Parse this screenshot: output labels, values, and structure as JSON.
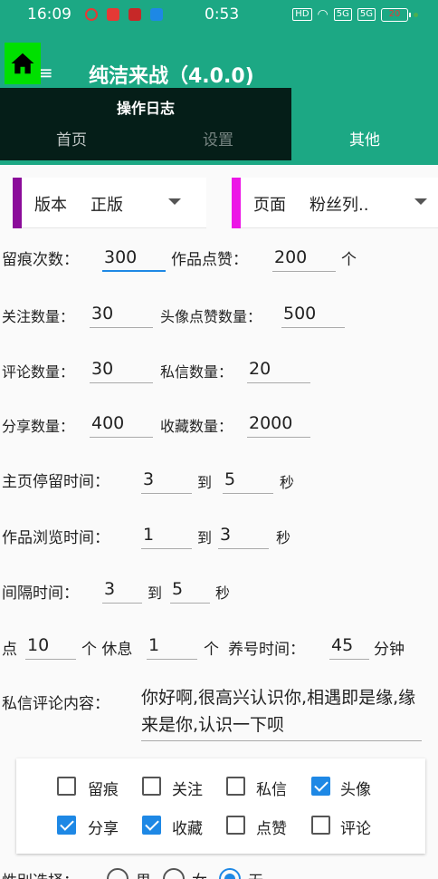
{
  "status_bar": {
    "time": "16:09",
    "center_time": "0:53",
    "battery": "20"
  },
  "app_bar": {
    "title": "纯洁来战（4.0.0)",
    "log_label": "操作日志"
  },
  "tabs": {
    "home": "首页",
    "settings": "设置",
    "other": "其他"
  },
  "spinners": {
    "version": {
      "label": "版本",
      "value": "正版",
      "accent": "#8b0c9a"
    },
    "page": {
      "label": "页面",
      "value": "粉丝列..",
      "accent": "#ec17e6"
    }
  },
  "form": {
    "trace_count_label": "留痕次数：",
    "trace_count": "300",
    "work_like_label": "作品点赞：",
    "work_like": "200",
    "work_like_unit": "个",
    "follow_label": "关注数量：",
    "follow": "30",
    "avatar_like_label": "头像点赞数量：",
    "avatar_like": "500",
    "comment_count_label": "评论数量：",
    "comment_count": "30",
    "dm_count_label": "私信数量：",
    "dm_count": "20",
    "share_label": "分享数量：",
    "share": "400",
    "fav_label": "收藏数量：",
    "fav": "2000",
    "home_stay_label": "主页停留时间：",
    "home_stay_min": "3",
    "home_stay_to": "到",
    "home_stay_max": "5",
    "home_stay_unit": "秒",
    "work_browse_label": "作品浏览时间：",
    "work_browse_min": "1",
    "work_browse_to": "到",
    "work_browse_max": "3",
    "work_browse_unit": "秒",
    "interval_label": "间隔时间：",
    "interval_min": "3",
    "interval_to": "到",
    "interval_max": "5",
    "interval_unit": "秒",
    "rest_prefix": "点",
    "rest_every": "10",
    "rest_every_unit": "个 休息",
    "rest_count": "1",
    "rest_count_unit": "个",
    "nurture_label": "养号时间：",
    "nurture": "45",
    "nurture_unit": "分钟",
    "dm_content_label": "私信评论内容：",
    "dm_content": "你好啊,很高兴认识你,相遇即是缘,缘来是你,认识一下呗"
  },
  "checkboxes": [
    {
      "label": "留痕",
      "checked": false
    },
    {
      "label": "关注",
      "checked": false
    },
    {
      "label": "私信",
      "checked": false
    },
    {
      "label": "头像",
      "checked": true
    },
    {
      "label": "分享",
      "checked": true
    },
    {
      "label": "收藏",
      "checked": true
    },
    {
      "label": "点赞",
      "checked": false
    },
    {
      "label": "评论",
      "checked": false
    }
  ],
  "gender": {
    "label": "性别选择：",
    "options": [
      "男",
      "女",
      "无"
    ],
    "selected": "无"
  },
  "colors": {
    "primary": "#1ca884",
    "accent": "#1e88e5",
    "home_button": "#00e000"
  }
}
